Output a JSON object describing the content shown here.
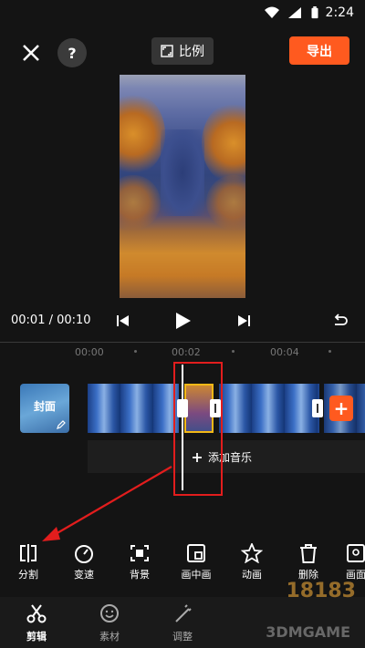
{
  "status_bar": {
    "time": "2:24"
  },
  "top_bar": {
    "ratio_label": "比例",
    "export_label": "导出",
    "help_label": "?"
  },
  "player": {
    "timecode": "00:01 / 00:10"
  },
  "timeline": {
    "ticks": [
      "00:00",
      "00:02",
      "00:04"
    ],
    "cover_label": "封面",
    "add_music_label": "添加音乐"
  },
  "toolbar": [
    {
      "label": "分割",
      "icon": "split-icon"
    },
    {
      "label": "变速",
      "icon": "speed-icon"
    },
    {
      "label": "背景",
      "icon": "background-icon"
    },
    {
      "label": "画中画",
      "icon": "pip-icon"
    },
    {
      "label": "动画",
      "icon": "animation-icon"
    },
    {
      "label": "删除",
      "icon": "delete-icon"
    },
    {
      "label": "画面",
      "icon": "frame-icon"
    }
  ],
  "bottom_nav": [
    {
      "label": "剪辑",
      "icon": "scissors-icon"
    },
    {
      "label": "素材",
      "icon": "sticker-icon"
    },
    {
      "label": "调整",
      "icon": "adjust-icon"
    }
  ],
  "watermark": {
    "text": "18183",
    "sub": "3DMGAME"
  },
  "colors": {
    "accent": "#ff5a1f",
    "highlight_box": "#e21d1d"
  }
}
